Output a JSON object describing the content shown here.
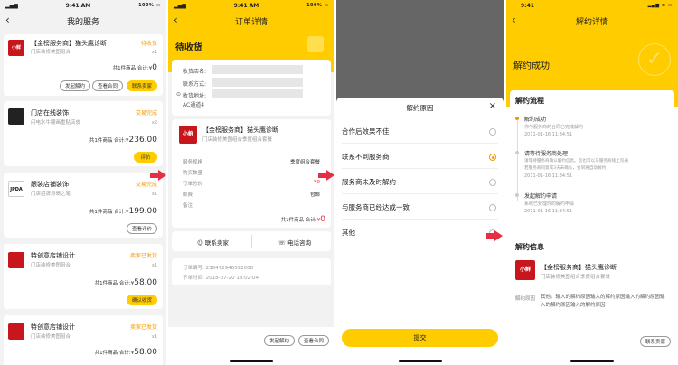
{
  "common": {
    "time": "9:41 AM",
    "battery": "100%"
  },
  "p1": {
    "title": "我的服务",
    "orders": [
      {
        "title": "【金榜服务商】猫头鹰诊断",
        "subtitle": "门店装修美图组合",
        "status": "待收货",
        "qty": "x1",
        "count": "共1件商品  合计:",
        "currency": "¥",
        "amount": "0",
        "buttons": [
          "发起解约",
          "查看合同",
          "联系卖家"
        ]
      },
      {
        "title": "门店在线装饰",
        "subtitle": "闪电水牛翻画重贴店皮",
        "status": "交易完成",
        "qty": "x2",
        "count": "共1件商品  合计:",
        "currency": "¥",
        "amount": "236.00",
        "buttons": [
          "评价"
        ]
      },
      {
        "title": "跟装店铺装饰",
        "subtitle": "门店招牌点睛之笔",
        "status": "交易完成",
        "qty": "x1",
        "count": "共1件商品  合计:",
        "currency": "¥",
        "amount": "199.00",
        "buttons": [
          "查看评价"
        ]
      },
      {
        "title": "特创意店铺设计",
        "subtitle": "门店装修美图组合",
        "status": "卖家已发货",
        "qty": "x1",
        "count": "共1件商品  合计:",
        "currency": "¥",
        "amount": "58.00",
        "buttons": [
          "确认收货"
        ]
      },
      {
        "title": "特创意店铺设计",
        "subtitle": "门店装修美图组合",
        "status": "卖家已发货",
        "qty": "x1",
        "count": "共1件商品  合计:",
        "currency": "¥",
        "amount": "58.00"
      }
    ]
  },
  "p2": {
    "title": "订单详情",
    "status": "待收货",
    "recv_name": "收货店名:",
    "recv_contact": "联系方式:",
    "recv_addr": "收货地址:",
    "recv_addr_val": "AC通道4",
    "product_title": "【金榜服务商】猫头鹰诊断",
    "product_sub": "门店装修美图组合季度组合套餐",
    "rows": [
      {
        "label": "服务规格",
        "value": "季度组合套餐"
      },
      {
        "label": "购买数量",
        "value": ""
      },
      {
        "label": "订单总价",
        "value": "¥0"
      },
      {
        "label": "邮费",
        "value": "包邮"
      },
      {
        "label": "备注",
        "value": ""
      }
    ],
    "count": "共1件商品  合计:",
    "currency": "¥",
    "amount": "0",
    "contact_seller": "联系卖家",
    "phone": "电话咨询",
    "order_no": "订单编号:  238472946592008",
    "order_time": "下单时间:  2018-07-20 18:02:04",
    "btn_cancel": "发起解约",
    "btn_contract": "查看合同"
  },
  "p3": {
    "title": "解约原因",
    "options": [
      "合作后效果不佳",
      "联系不到服务商",
      "服务商未及时解约",
      "与服务商已经达成一致",
      "其他"
    ],
    "selected": 1,
    "submit": "提交"
  },
  "p4": {
    "time": "9:41",
    "title": "解约详情",
    "success": "解约成功",
    "flow_title": "解约流程",
    "flow": [
      {
        "label": "解约成功",
        "desc": "你与服务商的合同已完成解约",
        "time": "2011-01-16 11:34:51"
      },
      {
        "label": "请等待服务商处理",
        "desc1": "请等待服务商确认解约信息。您也可以与服务商线上沟通",
        "desc2": "若服务商同意或3天未确认，合同将自动解约",
        "time": "2011-01-16 11:34:51"
      },
      {
        "label": "发起解约申请",
        "desc": "系统已受理你的解约申请",
        "time": "2011-01-16 11:34:51"
      }
    ],
    "info_title": "解约信息",
    "product_title": "【金榜服务商】猫头鹰诊断",
    "product_sub": "门店装修美图组合季度组合套餐",
    "reason_label": "解约原因",
    "reason_text": "其他。输入的解约原因输入的解约原因输入的解约原因输入的解约原因输入的解约原因",
    "contact_seller": "联系卖家"
  },
  "colors": {
    "accent": "#ffcc00",
    "orange": "#f39800",
    "red": "#e52d43"
  }
}
